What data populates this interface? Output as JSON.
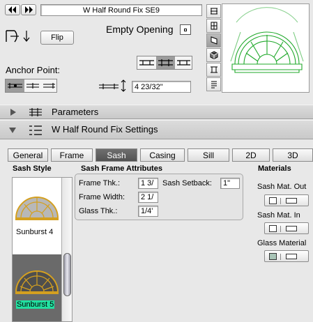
{
  "header": {
    "title": "W Half Round Fix SE9",
    "flip_label": "Flip",
    "empty_opening_label": "Empty Opening",
    "anchor_label": "Anchor Point:",
    "offset_value": "4 23/32\""
  },
  "sections": {
    "parameters": "Parameters",
    "settings": "W Half Round Fix Settings"
  },
  "tabs": [
    "General",
    "Frame",
    "Sash",
    "Casing",
    "Sill",
    "2D",
    "3D"
  ],
  "active_tab": "Sash",
  "sash_style": {
    "heading": "Sash Style",
    "items": [
      "Sunburst 4",
      "Sunburst 5"
    ],
    "selected": "Sunburst 5"
  },
  "sash_frame": {
    "heading": "Sash Frame Attributes",
    "frame_thk_label": "Frame Thk.:",
    "frame_thk_value": "1 3/",
    "frame_width_label": "Frame Width:",
    "frame_width_value": "2 1/",
    "glass_thk_label": "Glass Thk.:",
    "glass_thk_value": "1/4'",
    "setback_label": "Sash Setback:",
    "setback_value": "1\""
  },
  "materials": {
    "heading": "Materials",
    "items": [
      {
        "label": "Sash Mat. Out",
        "color": "#ffffff"
      },
      {
        "label": "Sash Mat. In",
        "color": "#ffffff"
      },
      {
        "label": "Glass Material",
        "color": "#a8c4b6"
      }
    ]
  },
  "colors": {
    "preview_green": "#1fa82a",
    "selection_highlight": "#22e0a0",
    "arch_gold": "#d4a020"
  }
}
